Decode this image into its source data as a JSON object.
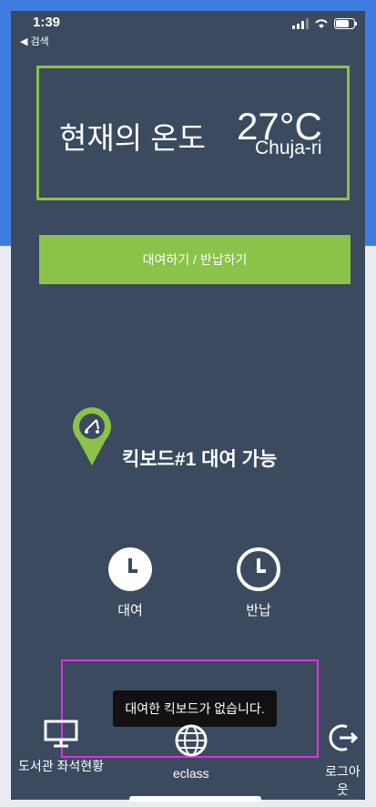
{
  "status": {
    "time": "1:39",
    "back_label": "◀ 검색"
  },
  "temperature": {
    "label": "현재의 온도",
    "value": "27°C",
    "location": "Chuja-ri"
  },
  "actions": {
    "rent_return_label": "대여하기 / 반납하기",
    "rent_label": "대여",
    "return_label": "반납"
  },
  "scooter": {
    "status_text": "킥보드#1 대여 가능"
  },
  "toast": {
    "message": "대여한 킥보드가 없습니다."
  },
  "nav": {
    "library_label": "도서관 좌석현황",
    "eclass_label": "eclass",
    "logout_label": "로그아웃"
  },
  "colors": {
    "background": "#3b4a5e",
    "accent": "#8bc34a",
    "border_blue": "#3f7de0"
  }
}
